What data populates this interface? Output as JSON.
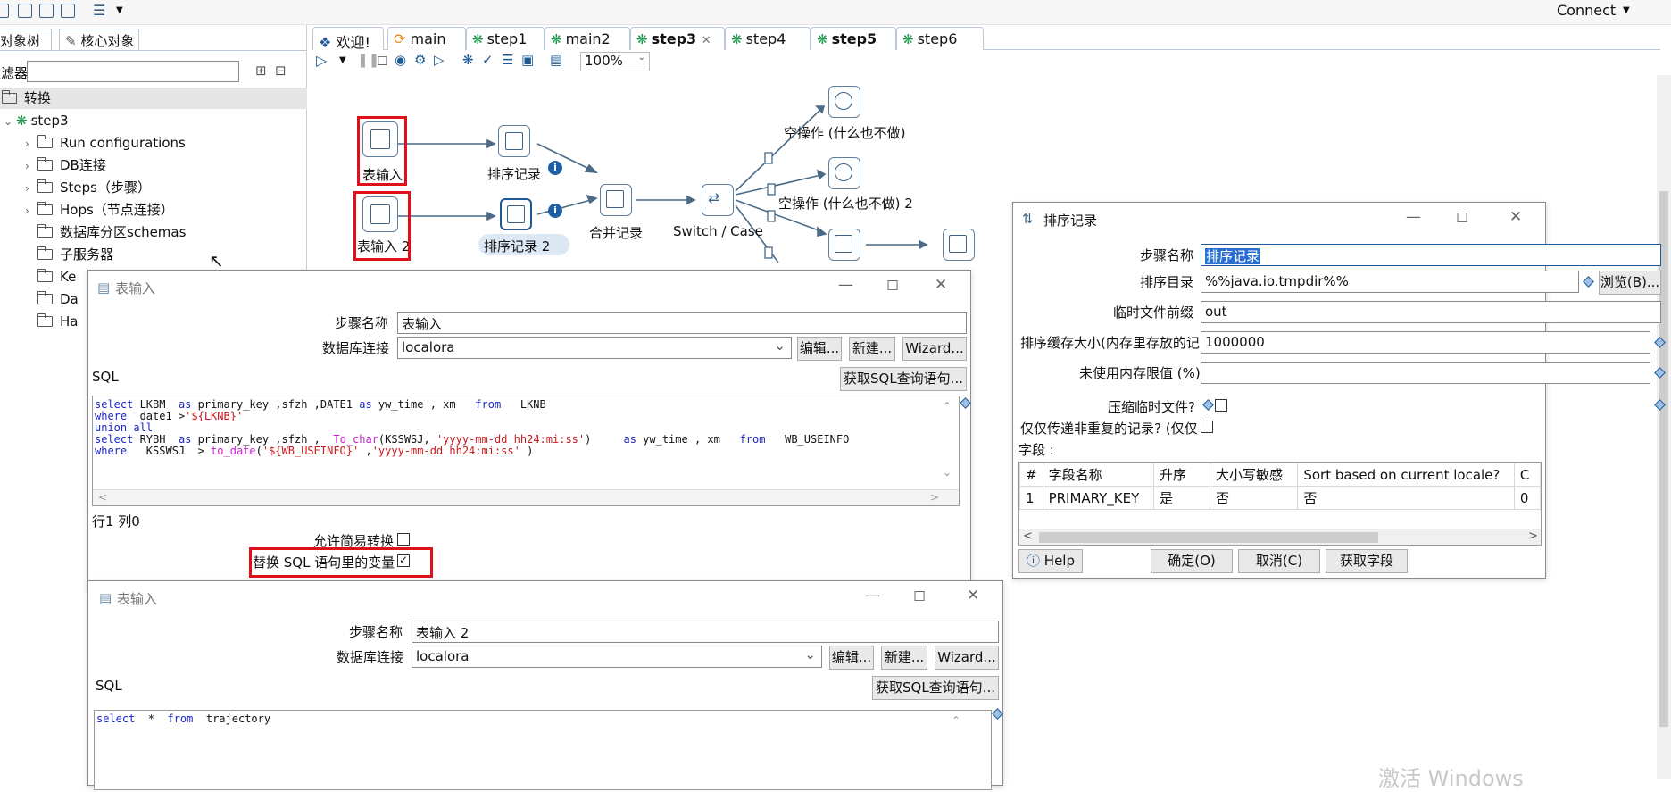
{
  "topbar": {
    "connect_label": "Connect"
  },
  "left_panel": {
    "tabs": [
      {
        "label": "主对象树"
      },
      {
        "label": "核心对象"
      }
    ],
    "filter_label": "过滤器",
    "tree": {
      "root": "转换",
      "transformation": "step3",
      "children": [
        {
          "label": "Run configurations"
        },
        {
          "label": "DB连接"
        },
        {
          "label": "Steps（步骤）"
        },
        {
          "label": "Hops（节点连接）"
        },
        {
          "label": "数据库分区schemas"
        },
        {
          "label": "子服务器"
        },
        {
          "label": "Ke"
        },
        {
          "label": "Da"
        },
        {
          "label": "Ha"
        }
      ]
    }
  },
  "tabs": [
    {
      "label": "欢迎!"
    },
    {
      "label": "main"
    },
    {
      "label": "step1"
    },
    {
      "label": "main2"
    },
    {
      "label": "step3"
    },
    {
      "label": "step4"
    },
    {
      "label": "step5"
    },
    {
      "label": "step6"
    }
  ],
  "canvas_toolbar": {
    "zoom": "100%"
  },
  "canvas": {
    "nodes": [
      {
        "label": "表输入"
      },
      {
        "label": "排序记录"
      },
      {
        "label": "表输入 2"
      },
      {
        "label": "排序记录 2"
      },
      {
        "label": "合并记录"
      },
      {
        "label": "Switch / Case"
      },
      {
        "label": "空操作 (什么也不做)"
      },
      {
        "label": "空操作 (什么也不做) 2"
      }
    ],
    "info_mark": "i"
  },
  "dialog_table_input_1": {
    "title": "表输入",
    "step_name_label": "步骤名称",
    "step_name_value": "表输入",
    "db_conn_label": "数据库连接",
    "db_conn_value": "localora",
    "edit_btn": "编辑...",
    "new_btn": "新建...",
    "wizard_btn": "Wizard...",
    "sql_label": "SQL",
    "get_sql_btn": "获取SQL查询语句...",
    "sql_lines": [
      "select LKBM  as primary_key ,sfzh ,DATE1 as yw_time , xm   from   LKNB",
      "where  date1 >'${LKNB}'",
      "union all",
      "select RYBH  as primary_key ,sfzh ,  To_char(KSSWSJ, 'yyyy-mm-dd hh24:mi:ss')     as yw_time , xm   from   WB_USEINFO",
      "where   KSSWSJ  > to_date('${WB_USEINFO}' ,'yyyy-mm-dd hh24:mi:ss' )"
    ],
    "row_col": "行1 列0",
    "lazy_label": "允许简易转换",
    "replace_vars_label": "替换 SQL 语句里的变量"
  },
  "dialog_table_input_2": {
    "title": "表输入",
    "step_name_label": "步骤名称",
    "step_name_value": "表输入 2",
    "db_conn_label": "数据库连接",
    "db_conn_value": "localora",
    "edit_btn": "编辑...",
    "new_btn": "新建...",
    "wizard_btn": "Wizard...",
    "sql_label": "SQL",
    "get_sql_btn": "获取SQL查询语句...",
    "sql_line": "select  *  from  trajectory"
  },
  "dialog_sort": {
    "title": "排序记录",
    "step_name_label": "步骤名称",
    "step_name_value": "排序记录",
    "sort_dir_label": "排序目录",
    "sort_dir_value": "%%java.io.tmpdir%%",
    "browse_btn": "浏览(B)...",
    "prefix_label": "临时文件前缀",
    "prefix_value": "out",
    "cache_label": "排序缓存大小(内存里存放的记",
    "cache_value": "1000000",
    "free_mem_label": "未使用内存限值 (%)",
    "compress_label": "压缩临时文件?",
    "unique_label": "仅仅传递非重复的记录? (仅仅",
    "fields_label": "字段 :",
    "columns": [
      "#",
      "字段名称",
      "升序",
      "大小写敏感",
      "Sort based on current locale?",
      "C"
    ],
    "rows": [
      {
        "num": "1",
        "name": "PRIMARY_KEY",
        "asc": "是",
        "case": "否",
        "locale": "否",
        "c": "0"
      }
    ],
    "help_btn": "Help",
    "ok_btn": "确定(O)",
    "cancel_btn": "取消(C)",
    "get_fields_btn": "获取字段"
  },
  "watermark": "激活 Windows"
}
